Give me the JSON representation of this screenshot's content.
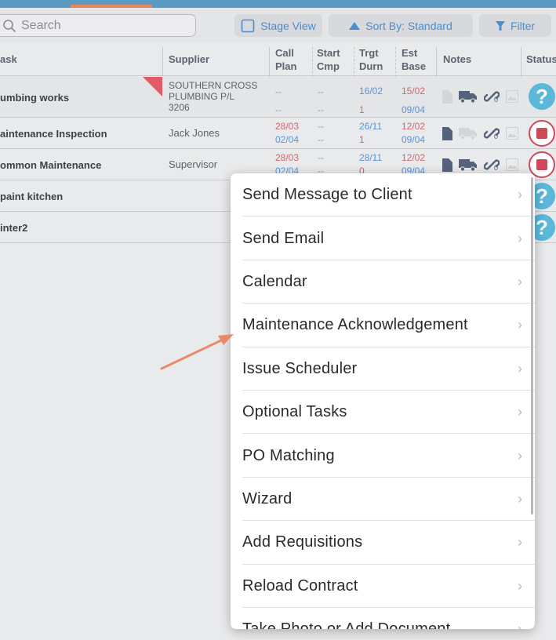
{
  "toolbar": {
    "search_placeholder": "Search",
    "stage_view_label": "Stage View",
    "sort_label": "Sort By: Standard",
    "filter_label": "Filter"
  },
  "table": {
    "headers": {
      "task": "ask",
      "supplier": "Supplier",
      "call_plan_1": "Call",
      "call_plan_2": "Plan",
      "start_cmp_1": "Start",
      "start_cmp_2": "Cmp",
      "trgt_durn_1": "Trgt",
      "trgt_durn_2": "Durn",
      "est_base_1": "Est",
      "est_base_2": "Base",
      "notes": "Notes",
      "status": "Status"
    },
    "rows": [
      {
        "task": "umbing works",
        "supplier_1": "SOUTHERN CROSS",
        "supplier_2": "PLUMBING P/L",
        "supplier_3": "3206",
        "call": "--",
        "plan": "--",
        "start": "--",
        "cmp": "--",
        "trgt": "16/02",
        "durn": "1",
        "est": "15/02",
        "base": "09/04",
        "attach_count": "0"
      },
      {
        "task": "aintenance Inspection",
        "supplier_1": "Jack Jones",
        "call": "28/03",
        "plan": "02/04",
        "start": "--",
        "cmp": "--",
        "trgt": "26/11",
        "durn": "1",
        "est": "12/02",
        "base": "09/04",
        "attach_count": "0"
      },
      {
        "task": "ommon Maintenance",
        "supplier_1": "Supervisor",
        "call": "28/03",
        "plan": "02/04",
        "start": "--",
        "cmp": "--",
        "trgt": "28/11",
        "durn": "0",
        "est": "12/02",
        "base": "09/04",
        "attach_count": "0"
      },
      {
        "task": "paint kitchen"
      },
      {
        "task": "inter2"
      }
    ]
  },
  "menu": {
    "items": [
      "Send Message to Client",
      "Send Email",
      "Calendar",
      "Maintenance Acknowledgement",
      "Issue Scheduler",
      "Optional Tasks",
      "PO Matching",
      "Wizard",
      "Add Requisitions",
      "Reload Contract",
      "Take Photo or Add Document"
    ],
    "chevron": "›"
  },
  "status_glyph": "?",
  "colors": {
    "accent_blue": "#4a8ed0",
    "top_strip": "#5b9ac1",
    "tab_indicator": "#e9895a",
    "arrow": "#e9896a",
    "status_question": "#5bb8d9",
    "status_stop": "#cf4a59",
    "date_red": "#d0666f",
    "date_blue": "#5a93d6"
  },
  "icons": {
    "search": "search-icon",
    "stage_view": "checkbox-icon",
    "sort": "triangle-up-icon",
    "filter": "filter-icon",
    "document": "document-icon",
    "truck": "truck-icon",
    "link": "link-icon",
    "photo": "photo-icon",
    "question": "question-status-icon",
    "stop": "stop-status-icon"
  }
}
